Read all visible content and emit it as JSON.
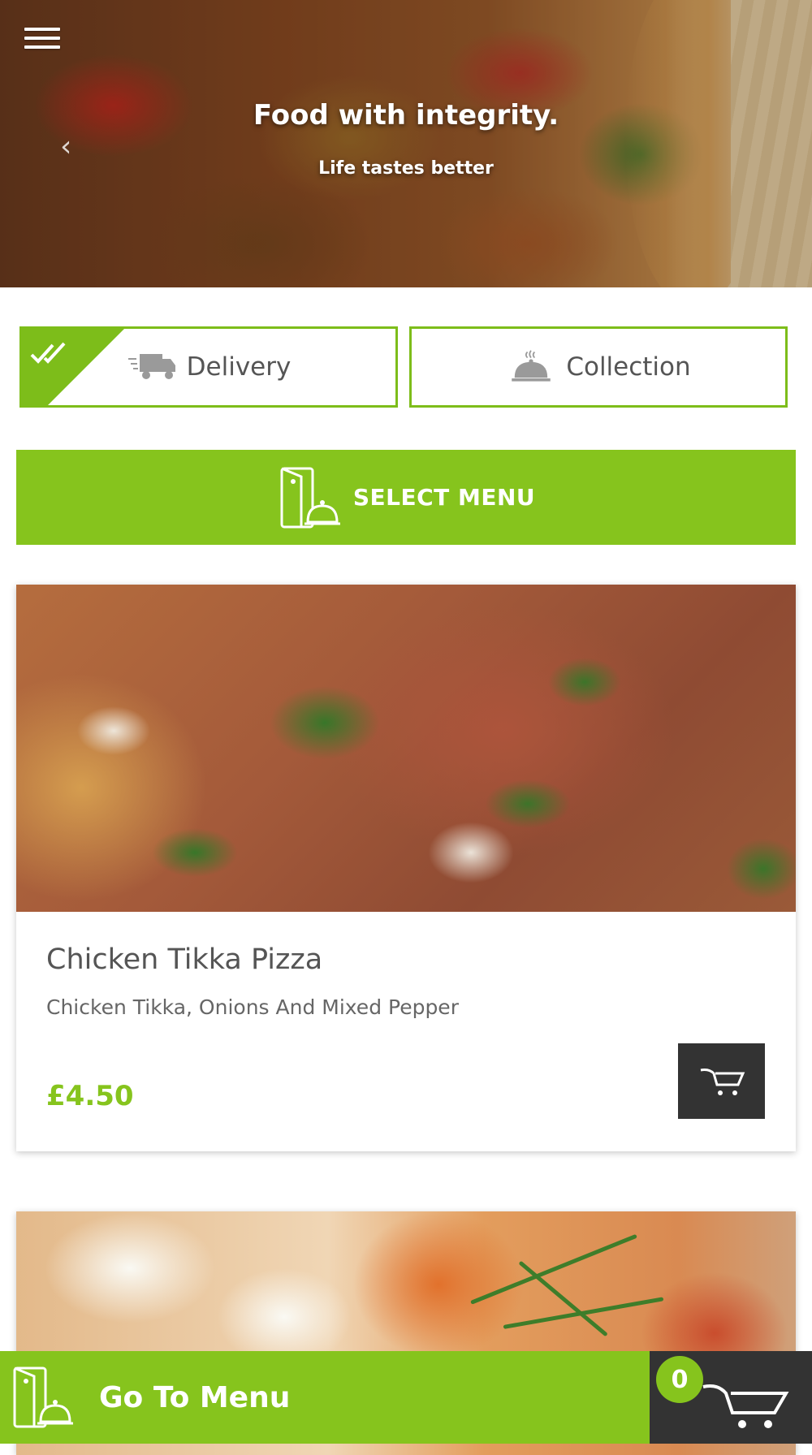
{
  "hero": {
    "title": "Food with integrity.",
    "subtitle": "Life tastes better"
  },
  "order_type": {
    "delivery_label": "Delivery",
    "collection_label": "Collection",
    "selected": "Delivery"
  },
  "select_menu": {
    "label": "SELECT MENU"
  },
  "products": [
    {
      "name": "Chicken Tikka Pizza",
      "description": "Chicken Tikka, Onions And Mixed Pepper",
      "price": "£4.50"
    }
  ],
  "bottom_bar": {
    "goto_menu_label": "Go To Menu",
    "cart_count": "0"
  },
  "colors": {
    "accent": "#86c41d",
    "dark": "#333333",
    "text": "#555555"
  },
  "icons": [
    "hamburger-menu-icon",
    "prev-slide-icon",
    "delivery-truck-icon",
    "cloche-icon",
    "double-check-icon",
    "menu-cloche-icon",
    "cart-icon"
  ]
}
